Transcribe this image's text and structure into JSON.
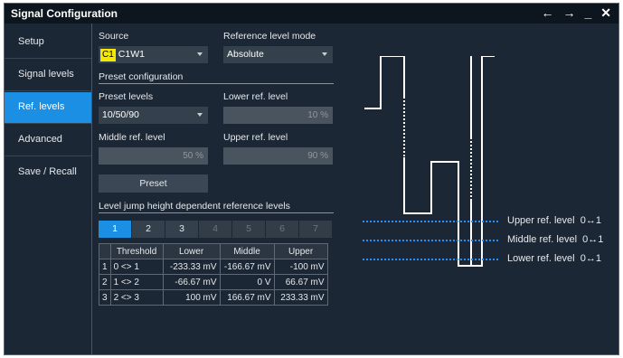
{
  "window": {
    "title": "Signal Configuration"
  },
  "titlebar_icons": [
    "arrow-left-icon",
    "arrow-right-icon",
    "minimize-icon",
    "close-icon"
  ],
  "sidebar": {
    "items": [
      {
        "label": "Setup",
        "active": false
      },
      {
        "label": "Signal levels",
        "active": false
      },
      {
        "label": "Ref. levels",
        "active": true
      },
      {
        "label": "Advanced",
        "active": false
      },
      {
        "label": "Save / Recall",
        "active": false
      }
    ]
  },
  "source": {
    "label": "Source",
    "badge": "C1",
    "value": "C1W1",
    "badge_color": "#f5e900"
  },
  "ref_mode": {
    "label": "Reference level mode",
    "value": "Absolute"
  },
  "preset_section": {
    "title": "Preset configuration"
  },
  "preset_levels": {
    "label": "Preset levels",
    "value": "10/50/90"
  },
  "lower_ref": {
    "label": "Lower ref. level",
    "value": "10 %"
  },
  "middle_ref": {
    "label": "Middle ref. level",
    "value": "50 %"
  },
  "upper_ref": {
    "label": "Upper ref. level",
    "value": "90 %"
  },
  "preset_button": {
    "label": "Preset"
  },
  "jump_section": {
    "title": "Level jump height dependent reference levels"
  },
  "tabs": [
    "1",
    "2",
    "3",
    "4",
    "5",
    "6",
    "7"
  ],
  "tabs_active": 0,
  "tabs_enabled": 3,
  "table": {
    "headers": [
      "Threshold",
      "Lower",
      "Middle",
      "Upper"
    ],
    "rows": [
      {
        "idx": "1",
        "threshold": "0 <> 1",
        "lower": "-233.33 mV",
        "middle": "-166.67 mV",
        "upper": "-100 mV"
      },
      {
        "idx": "2",
        "threshold": "1 <> 2",
        "lower": "-66.67 mV",
        "middle": "0 V",
        "upper": "66.67 mV"
      },
      {
        "idx": "3",
        "threshold": "2 <> 3",
        "lower": "100 mV",
        "middle": "166.67 mV",
        "upper": "233.33 mV"
      }
    ]
  },
  "diagram": {
    "upper_label": "Upper ref. level",
    "middle_label": "Middle ref. level",
    "lower_label": "Lower ref. level",
    "upper_suffix": "0↔1",
    "middle_suffix": "0↔1",
    "lower_suffix": "0↔1",
    "line_color": "#1e90ff"
  }
}
